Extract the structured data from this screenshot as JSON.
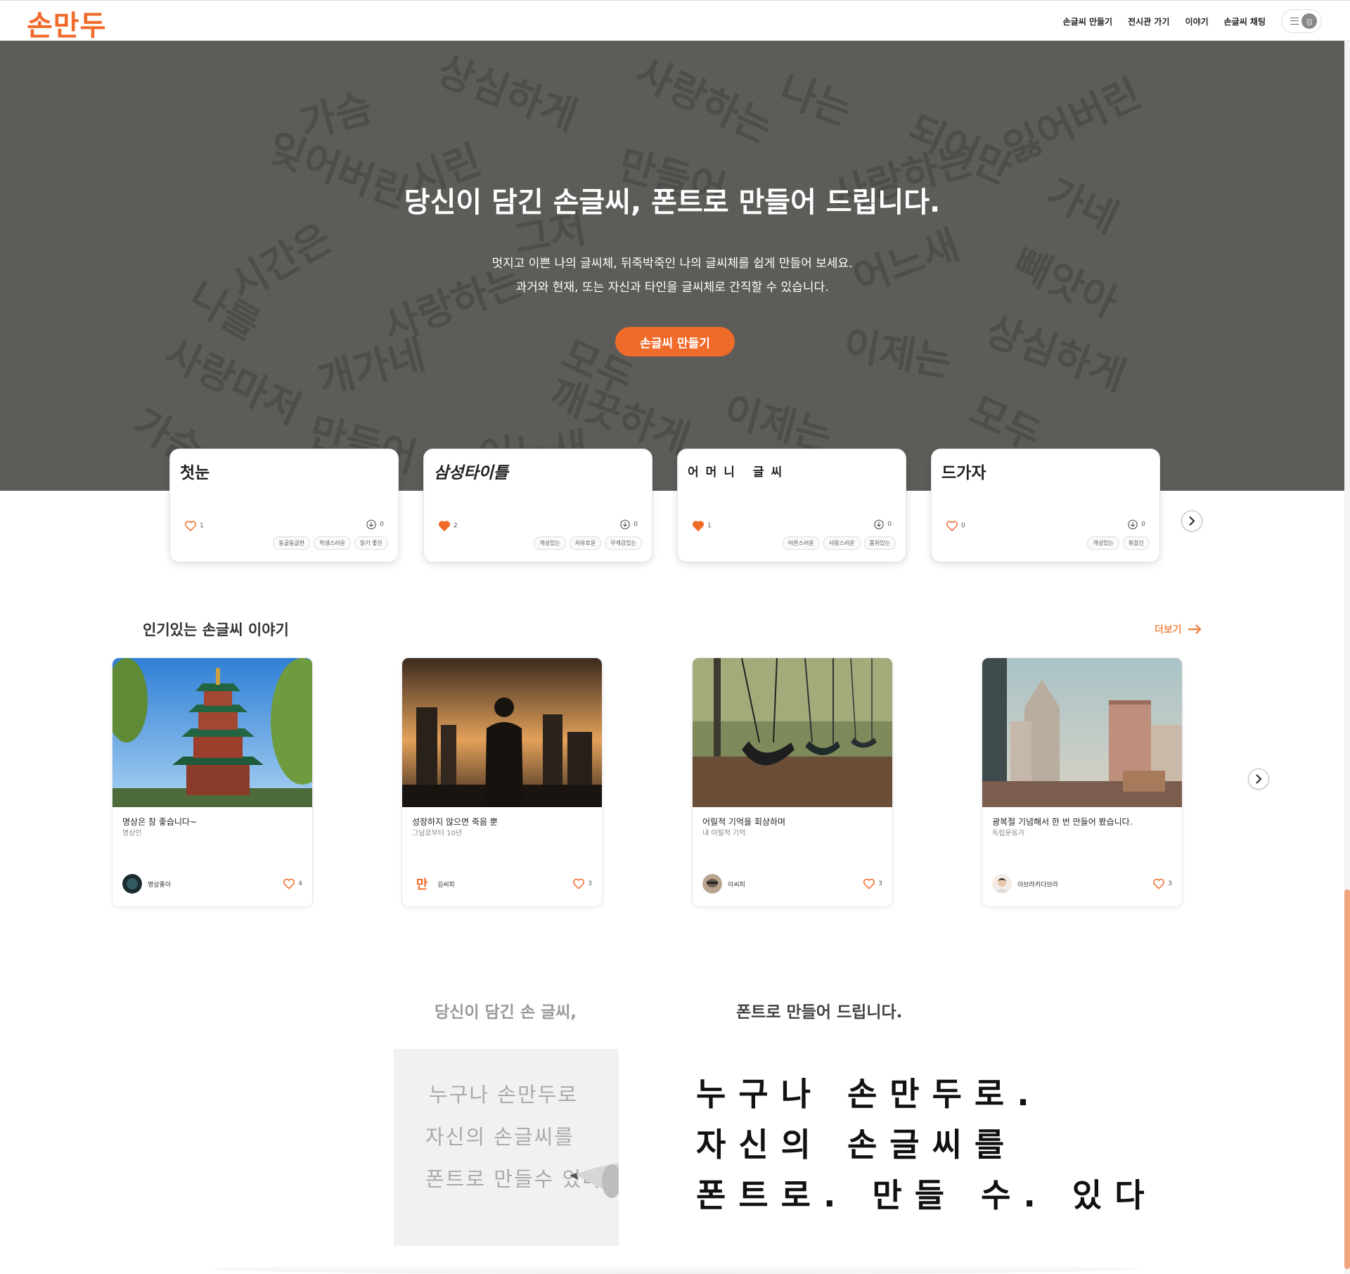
{
  "header": {
    "logo": "손만두",
    "nav": [
      "손글씨 만들기",
      "전시관 가기",
      "이야기",
      "손글씨 채팅"
    ],
    "user_initial": "김"
  },
  "hero": {
    "title": "당신이 담긴 손글씨, 폰트로 만들어 드립니다.",
    "subtitle_line1": "멋지고 이쁜 나의 글씨체, 뒤죽박죽인 나의 글씨체를 쉽게 만들어 보세요.",
    "subtitle_line2": "과거와 현재, 또는 자신과 타인을 글씨체로 간직할 수 있습니다.",
    "cta": "손글씨 만들기",
    "background_words": [
      "가슴",
      "상심하게",
      "사랑하는",
      "나는",
      "잃어버린",
      "되어만",
      "잊어버린",
      "시린",
      "만들어",
      "사랑하는",
      "가네",
      "시간은",
      "그저",
      "어느새",
      "빼앗아",
      "나를",
      "사랑하는",
      "모두",
      "이제는",
      "상심하게",
      "사랑마저",
      "개가네",
      "깨끗하게",
      "이제는",
      "모두",
      "가슴",
      "만들어",
      "어느새",
      "돼"
    ]
  },
  "fonts": [
    {
      "name": "첫눈",
      "likes": "1",
      "liked": false,
      "downloads": "0",
      "tags": [
        "동글동글한",
        "학생스러운",
        "읽기 좋은"
      ]
    },
    {
      "name": "삼성타이틀",
      "likes": "2",
      "liked": true,
      "downloads": "0",
      "tags": [
        "개성있는",
        "자유로운",
        "무게감있는"
      ]
    },
    {
      "name": "어머니 글씨",
      "likes": "1",
      "liked": true,
      "downloads": "0",
      "tags": [
        "어른스러운",
        "사랑스러운",
        "품위있는"
      ]
    },
    {
      "name": "드가자",
      "likes": "0",
      "liked": false,
      "downloads": "0",
      "tags": [
        "개성있는",
        "휘갈긴"
      ]
    }
  ],
  "stories_section": {
    "title": "인기있는 손글씨 이야기",
    "more": "더보기"
  },
  "stories": [
    {
      "title": "명상은 참 좋습니다~",
      "subtitle": "명상인",
      "author": "명상좋아",
      "likes": "4"
    },
    {
      "title": "성장하지 않으면 죽음 뿐",
      "subtitle": "그날로부터 10년",
      "author": "김씨피",
      "likes": "3"
    },
    {
      "title": "어릴적 기억을 회상하며",
      "subtitle": "내 어릴적 기억",
      "author": "이씨피",
      "likes": "3"
    },
    {
      "title": "광복절 기념해서 한 번 만들어 봤습니다.",
      "subtitle": "독립운동가",
      "author": "아브라카다브라",
      "likes": "3"
    }
  ],
  "demo": {
    "left_title": "당신이 담긴 손 글씨,",
    "right_title": "폰트로 만들어 드립니다.",
    "handwriting_lines": [
      "누구나  손만두로",
      "자신의  손글씨를",
      "폰트로  만들수  있다"
    ],
    "font_lines": [
      "누구나 손만두로.",
      "자신의 손글씨를",
      "폰트로. 만들 수. 있다"
    ]
  },
  "colors": {
    "accent": "#f06a2a",
    "hero_bg": "#5e5c59"
  }
}
